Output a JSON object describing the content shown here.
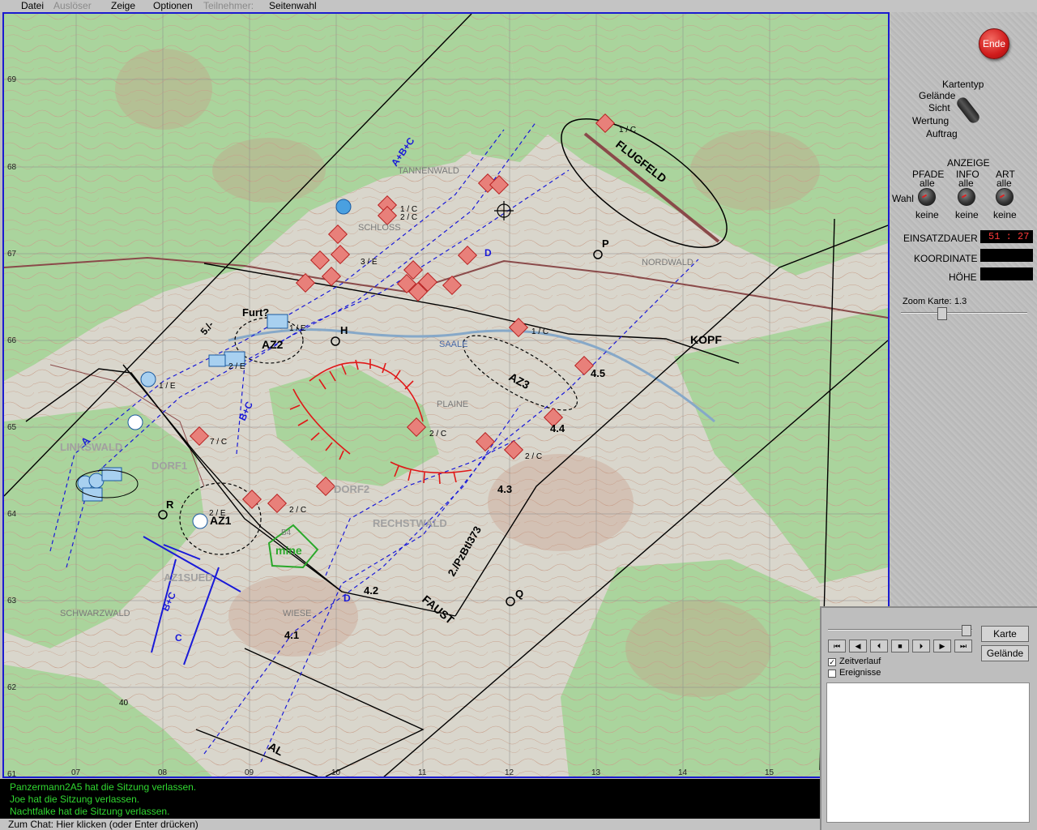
{
  "menu": {
    "items": [
      {
        "label": "Datei",
        "enabled": true
      },
      {
        "label": "Auslöser",
        "enabled": false
      },
      {
        "label": "Zeige",
        "enabled": true
      },
      {
        "label": "Optionen",
        "enabled": true
      },
      {
        "label": "Teilnehmer:",
        "enabled": false
      },
      {
        "label": "Seitenwahl",
        "enabled": true
      }
    ]
  },
  "panel": {
    "end_label": "Ende",
    "map_type": {
      "title": "Kartentyp",
      "options": [
        "Gelände",
        "Sicht",
        "Wertung",
        "Auftrag"
      ]
    },
    "display": {
      "title": "ANZEIGE",
      "wahl_label": "Wahl",
      "columns": [
        {
          "header": "PFADE",
          "value": "alle",
          "setting": "keine"
        },
        {
          "header": "INFO",
          "value": "alle",
          "setting": "keine"
        },
        {
          "header": "ART",
          "value": "alle",
          "setting": "keine"
        }
      ]
    },
    "einsatzdauer": {
      "label": "EINSATZDAUER",
      "value": "51 : 27"
    },
    "koordinate": {
      "label": "KOORDINATE",
      "value": ""
    },
    "hoehe": {
      "label": "HÖHE",
      "value": ""
    },
    "zoom": {
      "label": "Zoom Karte:",
      "value": "1.3"
    }
  },
  "map": {
    "grid_left": [
      "69",
      "68",
      "67",
      "66",
      "65",
      "64",
      "63",
      "62",
      "61"
    ],
    "grid_bottom": [
      "07",
      "08",
      "09",
      "10",
      "11",
      "12",
      "13",
      "14",
      "15"
    ],
    "place_names": [
      "TANNENWALD",
      "SCHLOSS",
      "NORDWALD",
      "SAALE",
      "PLAINE",
      "LINKSWALD",
      "DORF1",
      "DORF2",
      "RECHSTWALD",
      "AZ1SUED",
      "SCHWARZWALD",
      "WIESE"
    ],
    "zone_labels": [
      "FLUGFELD",
      "KOPF",
      "AZ1",
      "AZ2",
      "AZ3",
      "mine",
      "FAUST",
      "AL",
      "2./PzBtl373",
      "Furt?",
      "A+B+C",
      "B+C",
      "D",
      "A",
      "C",
      "5./-",
      "4.1",
      "4.2",
      "4.3",
      "4.4",
      "4.5",
      "H",
      "P",
      "Q",
      "R",
      "O",
      "40",
      "B4"
    ],
    "unit_labels": [
      "1 / C",
      "2 / C",
      "1 / E",
      "2 / E",
      "7 / C",
      "3 / E",
      "1 / C",
      "2 / C"
    ]
  },
  "chat": {
    "lines": [
      "Panzermann2A5 hat die Sitzung verlassen.",
      "Joe hat die Sitzung verlassen.",
      "Nachtfalke hat die Sitzung verlassen."
    ],
    "input_placeholder": "Zum Chat: Hier klicken (oder Enter drücken)"
  },
  "playback": {
    "buttons": [
      "⏮",
      "◀",
      "⏴",
      "■",
      "⏵",
      "▶",
      "⏭"
    ],
    "karte_label": "Karte",
    "gelaende_label": "Gelände",
    "zeitverlauf": {
      "label": "Zeitverlauf",
      "checked": true
    },
    "ereignisse": {
      "label": "Ereignisse",
      "checked": false
    }
  },
  "colors": {
    "enemy_fill": "#e8807a",
    "friendly_fill": "#4aa0e0",
    "route": "#1a1ad8",
    "obstacle": "#e01818",
    "mine": "#2aa82a",
    "boundary": "#000000",
    "forest": "#a8d49a"
  }
}
